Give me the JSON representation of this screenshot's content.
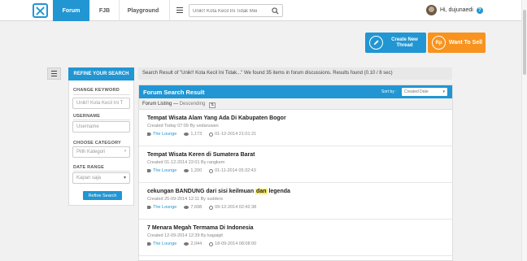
{
  "nav": {
    "tabs": [
      {
        "label": "Forum",
        "active": true
      },
      {
        "label": "FJB",
        "active": false
      },
      {
        "label": "Playground",
        "active": false
      }
    ],
    "search_value": "Unik!! Kota Kecil Ini Tidak Mei",
    "user_greeting": "Hi, dujunaedi",
    "help_label": "?"
  },
  "actions": {
    "create_thread": "Create New Thread",
    "sell_icon": "Rp",
    "want_to_sell": "Want To Sell"
  },
  "refine": {
    "tab_label": "REFINE YOUR SEARCH",
    "keyword_label": "CHANGE KEYWORD",
    "keyword_value": "Unik!! Kota Kecil Ini T",
    "username_label": "USERNAME",
    "username_placeholder": "Username",
    "category_label": "CHOOSE CATEGORY",
    "category_placeholder": "Pilih Kategori",
    "date_label": "DATE RANGE",
    "date_value": "Kapan saja",
    "button_label": "Refine Search"
  },
  "summary": "Search Result of \"Unik!! Kota Kecil Ini Tidak...\" We found 35 items in forum discussions. Results found (0.10 / 8 sec)",
  "results": {
    "title": "Forum Search Result",
    "sort_label": "Sort by :",
    "sort_value": "Created Date",
    "listing_label": "Forum Listing —",
    "listing_order": "Descending",
    "items": [
      {
        "title_before": "Tempat Wisata Alam Yang Ada Di Kabupaten Bogor",
        "highlight": "",
        "title_after": "",
        "meta": "Created Today 07:09 By undaruwan",
        "category": "The Lounge",
        "views": "1,173",
        "date": "01-12-2014 21:01:21"
      },
      {
        "title_before": "Tempat Wisata Keren di Sumatera Barat",
        "highlight": "",
        "title_after": "",
        "meta": "Created 01-12-2014 22:01 By rangkem",
        "category": "The Lounge",
        "views": "1,200",
        "date": "01-11-2014 05:32:43"
      },
      {
        "title_before": "cekungan BANDUNG dari sisi keilmuan ",
        "highlight": "dan",
        "title_after": " legenda",
        "meta": "Created 25-09-2014 12:11 By sudders",
        "category": "The Lounge",
        "views": "7,698",
        "date": "09-12-2014 02:42:38"
      },
      {
        "title_before": "7 Menara Megah Termama Di Indonesia",
        "highlight": "",
        "title_after": "",
        "meta": "Created 12-09-2014 12:39 By kagaigit",
        "category": "The Lounge",
        "views": "2,044",
        "date": "18-09-2014 08:08:00"
      }
    ]
  }
}
